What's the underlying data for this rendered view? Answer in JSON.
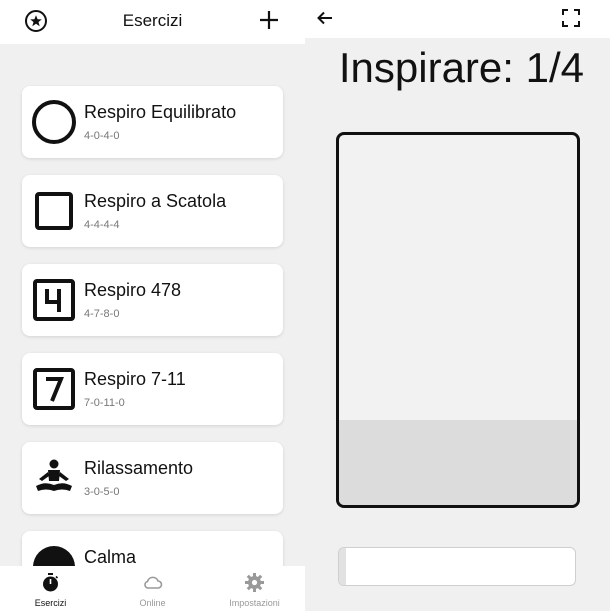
{
  "left": {
    "header": {
      "title": "Esercizi",
      "left_icon": "star-circle-icon",
      "right_icon": "plus-icon"
    },
    "exercises": [
      {
        "name": "Respiro Equilibrato",
        "pattern": "4-0-4-0",
        "icon": "circle-icon"
      },
      {
        "name": "Respiro a Scatola",
        "pattern": "4-4-4-4",
        "icon": "square-icon"
      },
      {
        "name": "Respiro 478",
        "pattern": "4-7-8-0",
        "icon": "number-4-box-icon"
      },
      {
        "name": "Respiro 7-11",
        "pattern": "7-0-11-0",
        "icon": "number-7-box-icon"
      },
      {
        "name": "Rilassamento",
        "pattern": "3-0-5-0",
        "icon": "meditation-icon"
      },
      {
        "name": "Calma",
        "pattern": "",
        "icon": "calm-icon"
      }
    ],
    "nav": [
      {
        "label": "Esercizi",
        "icon": "stopwatch-icon",
        "active": true
      },
      {
        "label": "Online",
        "icon": "cloud-icon",
        "active": false
      },
      {
        "label": "Impostazioni",
        "icon": "gear-icon",
        "active": false
      }
    ]
  },
  "right": {
    "toolbar": {
      "back_icon": "arrow-left-icon",
      "fullscreen_icon": "fullscreen-icon"
    },
    "phase_label": "Inspirare: 1/4",
    "breath_fill_fraction": 0.23,
    "session_progress_fraction": 0.03,
    "colors": {
      "fill": "#dcdcdc",
      "border": "#111111",
      "background": "#f0f0f0"
    }
  }
}
